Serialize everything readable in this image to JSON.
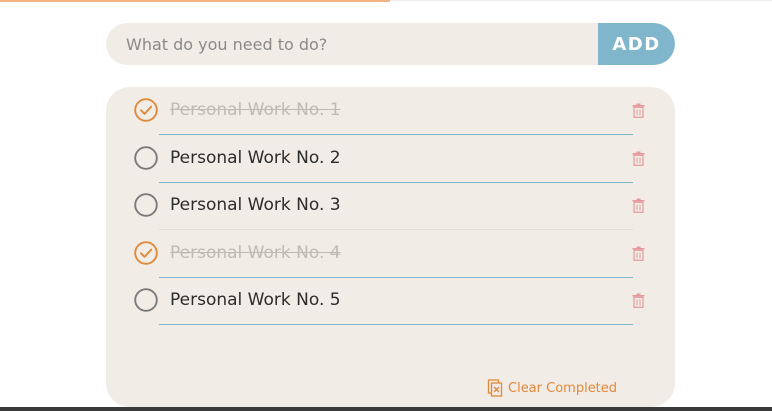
{
  "header": {
    "accent_color": "#f2b483"
  },
  "input": {
    "placeholder": "What do you need to do?",
    "value": ""
  },
  "add_button": {
    "label": "ADD",
    "color": "#7fb6cc"
  },
  "tasks": [
    {
      "label": "Personal Work No. 1",
      "completed": true
    },
    {
      "label": "Personal Work No. 2",
      "completed": false
    },
    {
      "label": "Personal Work No. 3",
      "completed": false
    },
    {
      "label": "Personal Work No. 4",
      "completed": true
    },
    {
      "label": "Personal Work No. 5",
      "completed": false
    }
  ],
  "clear_completed": {
    "label": "Clear Completed"
  },
  "colors": {
    "panel": "#f1ece6",
    "check_done": "#e0893a",
    "check_open": "#7a7a7a",
    "trash": "#e59a9a",
    "done_text": "#bfbab4"
  },
  "icons": {
    "check_done": "check-circle-icon",
    "check_open": "empty-circle-icon",
    "delete": "trash-icon",
    "clear": "clear-document-icon"
  }
}
